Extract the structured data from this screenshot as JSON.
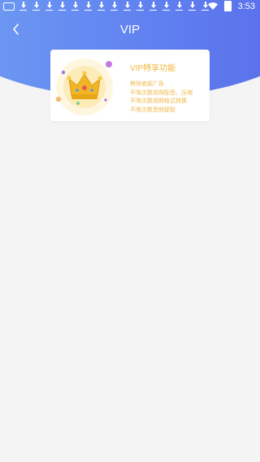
{
  "status_bar": {
    "time": "3:53",
    "notification_icons": [
      "message-icon",
      "download-icon",
      "download-icon",
      "download-icon",
      "download-icon",
      "download-icon",
      "download-icon",
      "download-icon",
      "download-icon",
      "download-icon",
      "download-icon",
      "download-icon",
      "download-icon",
      "download-icon",
      "download-icon",
      "download-icon"
    ]
  },
  "header": {
    "title": "VIP",
    "back_icon": "chevron-left-icon",
    "gradient_colors": [
      "#6f9df2",
      "#5a6be8"
    ]
  },
  "vip_card": {
    "title": "VIP特享功能",
    "features": [
      "移除底部广告",
      "不限次数视频配音、压缩",
      "不限次数视频格式转换",
      "不限次数音频提取"
    ],
    "icon": "crown-icon",
    "accent_color": "#f0b33a"
  }
}
